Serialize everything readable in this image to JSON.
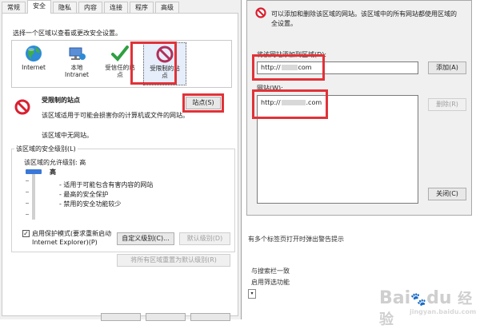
{
  "tabs": [
    "常规",
    "安全",
    "隐私",
    "内容",
    "连接",
    "程序",
    "高级"
  ],
  "security_tab": {
    "zone_prompt": "选择一个区域以查看或更改安全设置。",
    "zones": [
      {
        "line1": "Internet",
        "line2": "",
        "icon": "globe-icon"
      },
      {
        "line1": "本地",
        "line2": "Intranet",
        "icon": "intranet-icon"
      },
      {
        "line1": "受信任的站",
        "line2": "点",
        "icon": "checkmark-icon"
      },
      {
        "line1": "受限制的站",
        "line2": "点",
        "icon": "restricted-icon"
      }
    ],
    "zone_title": "受限制的站点",
    "zone_desc1": "该区域适用于可能会损害你的计算机或文件的网站。",
    "zone_desc2": "该区域中无网站。",
    "sites_button": "站点(S)",
    "group_title": "该区域的安全级别(L)",
    "allowed_level": "该区域的允许级别: 高",
    "level_name": "高",
    "bullets": [
      "- 适用于可能包含有害内容的网站",
      "- 最高的安全保护",
      "- 禁用的安全功能较少"
    ],
    "protected_mode_line1": "启用保护模式(要求重新启动",
    "protected_mode_line2": "Internet Explorer)(P)",
    "custom_level_button": "自定义级别(C)...",
    "default_level_button": "默认级别(D)",
    "reset_all_button": "将所有区域重置为默认级别(R)"
  },
  "restricted_dialog": {
    "info_text_1": "可以添加和删除该区域的网站。该区域中的所有网站都使用区域的",
    "info_text_2": "全设置。",
    "add_label": "将该网站添加到区域(D):",
    "add_value_prefix": "http://",
    "add_value_suffix": "com",
    "add_button": "添加(A)",
    "websites_label": "网站(W):",
    "website_entry_prefix": "http://",
    "website_entry_suffix": ".com",
    "remove_button": "删除(R)",
    "close_button": "关闭(C)"
  },
  "background_fragments": {
    "line1": "有多个标签页打开时弹出警告提示",
    "line2": "与搜索栏一致",
    "line3": "启用筛选功能"
  },
  "watermark": {
    "brand": "Bai",
    "paw": "du",
    "jingyan_cn": "经验",
    "jingyan_domain": "jingyan.baidu.com"
  },
  "colors": {
    "highlight_red": "#e13238",
    "selection_blue": "#e6eefb",
    "restricted_icon": "#b0305a"
  }
}
